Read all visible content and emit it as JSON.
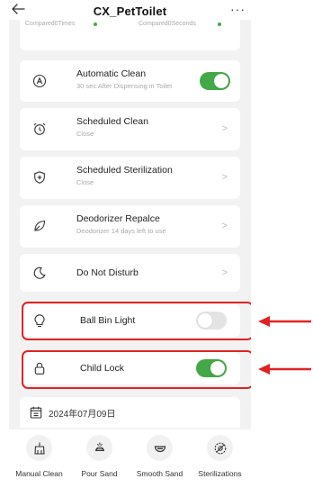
{
  "header": {
    "title": "CX_PetToilet",
    "back_icon": "arrow-left-icon",
    "more": "···"
  },
  "faded_row": {
    "left_text": "Compared0Times",
    "right_text": "Compared0Seconds"
  },
  "settings": [
    {
      "key": "automatic_clean",
      "icon": "auto-a-icon",
      "title": "Automatic Clean",
      "subtitle": "30 sec After Dispensing in Toilet",
      "control": "toggle",
      "on": true
    },
    {
      "key": "scheduled_clean",
      "icon": "alarm-clock-icon",
      "title": "Scheduled Clean",
      "subtitle": "Close",
      "control": "chevron"
    },
    {
      "key": "scheduled_sterilization",
      "icon": "shield-plus-icon",
      "title": "Scheduled Sterilization",
      "subtitle": "Close",
      "control": "chevron"
    },
    {
      "key": "deodorizer",
      "icon": "leaf-icon",
      "title": "Deodorizer Repalce",
      "subtitle": "Deodorizer 14 days left to use",
      "control": "chevron"
    },
    {
      "key": "do_not_disturb",
      "icon": "moon-icon",
      "title": "Do Not Disturb",
      "subtitle": "",
      "control": "chevron"
    },
    {
      "key": "ball_bin_light",
      "icon": "lightbulb-icon",
      "title": "Ball Bin Light",
      "subtitle": "",
      "control": "toggle",
      "on": false,
      "highlighted": true
    },
    {
      "key": "child_lock",
      "icon": "lock-icon",
      "title": "Child Lock",
      "subtitle": "",
      "control": "toggle",
      "on": true,
      "highlighted": true
    }
  ],
  "chevron_glyph": ">",
  "date_row": {
    "icon": "calendar-icon",
    "text": "2024年07月09日"
  },
  "bottom_actions": [
    {
      "label": "Manual Clean",
      "icon": "broom-icon"
    },
    {
      "label": "Pour Sand",
      "icon": "pour-sand-icon"
    },
    {
      "label": "Smooth Sand",
      "icon": "smooth-sand-icon"
    },
    {
      "label": "Sterilizations",
      "icon": "sterilize-icon"
    }
  ],
  "colors": {
    "toggle_on": "#43a847",
    "toggle_off": "#e4e4e4",
    "highlight": "#e12222",
    "background": "#f2f2f2"
  }
}
